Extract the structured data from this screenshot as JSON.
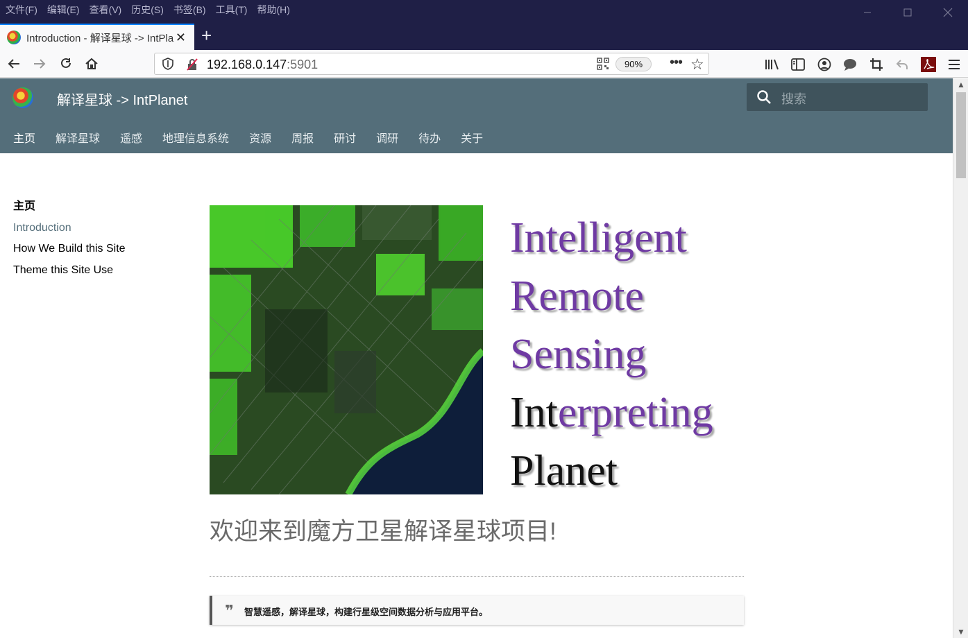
{
  "browser": {
    "menus": [
      "文件(F)",
      "编辑(E)",
      "查看(V)",
      "历史(S)",
      "书签(B)",
      "工具(T)",
      "帮助(H)"
    ],
    "tab_title": "Introduction - 解译星球 -> IntPlanet",
    "url_host": "192.168.0.147",
    "url_port": ":5901",
    "zoom": "90%",
    "more": "•••"
  },
  "site": {
    "title": "解译星球 -> IntPlanet",
    "search_placeholder": "搜索",
    "tabs": [
      "主页",
      "解译星球",
      "遥感",
      "地理信息系统",
      "资源",
      "周报",
      "研讨",
      "调研",
      "待办",
      "关于"
    ]
  },
  "sidebar": {
    "active": "主页",
    "items": [
      "Introduction",
      "How We Build this Site",
      "Theme this Site Use"
    ]
  },
  "hero_words": {
    "line1": "Intelligent",
    "line2": "Remote",
    "line3": "Sensing",
    "line4a": "Int",
    "line4b": "erpreting",
    "line5": "Planet"
  },
  "content": {
    "welcome": "欢迎来到魔方卫星解译星球项目!",
    "quote_mark": "❞",
    "quote": "智慧遥感，解译星球，构建行星级空间数据分析与应用平台。"
  },
  "colors": {
    "header": "#546e7a",
    "accent_purple": "#6f3aa3",
    "chrome_dark": "#1f1f46"
  }
}
